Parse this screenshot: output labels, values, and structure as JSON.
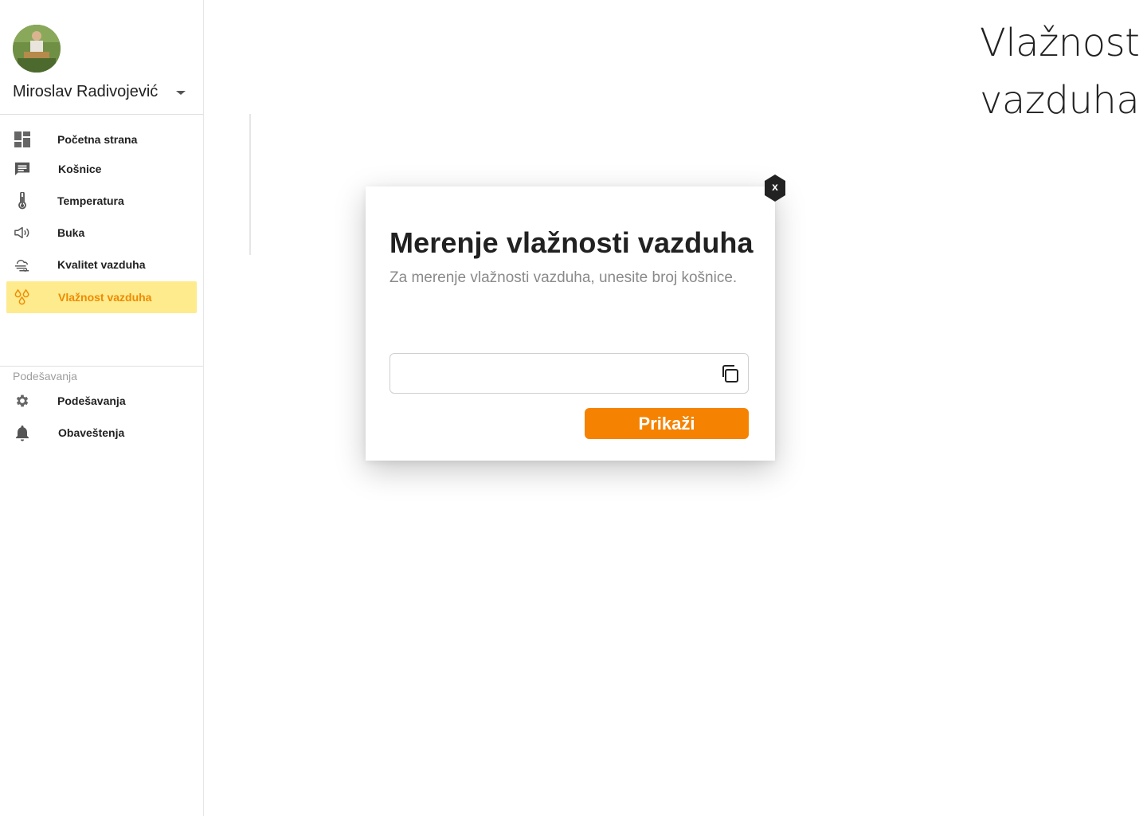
{
  "user": {
    "name": "Miroslav Radivojević"
  },
  "nav": {
    "items": [
      {
        "label": "Početna strana",
        "icon": "dashboard-icon"
      },
      {
        "label": "Košnice",
        "icon": "chat-icon"
      },
      {
        "label": "Temperatura",
        "icon": "thermometer-icon"
      },
      {
        "label": "Buka",
        "icon": "speaker-icon"
      },
      {
        "label": "Kvalitet vazduha",
        "icon": "air-icon"
      },
      {
        "label": "Vlažnost vazduha",
        "icon": "droplets-icon",
        "active": true
      }
    ],
    "settings_label": "Podešavanja",
    "settings_items": [
      {
        "label": "Podešavanja",
        "icon": "gear-icon"
      },
      {
        "label": "Obaveštenja",
        "icon": "bell-icon"
      }
    ]
  },
  "page": {
    "title": "Vlažnost vazduha"
  },
  "modal": {
    "title": "Merenje vlažnosti vazduha",
    "subtitle": "Za merenje vlažnosti vazduha, unesite broj košnice.",
    "input_value": "",
    "submit_label": "Prikaži",
    "close_label": "x"
  },
  "colors": {
    "accent": "#f58200",
    "active_bg": "#fdeb8e",
    "active_text": "#f08a00"
  }
}
